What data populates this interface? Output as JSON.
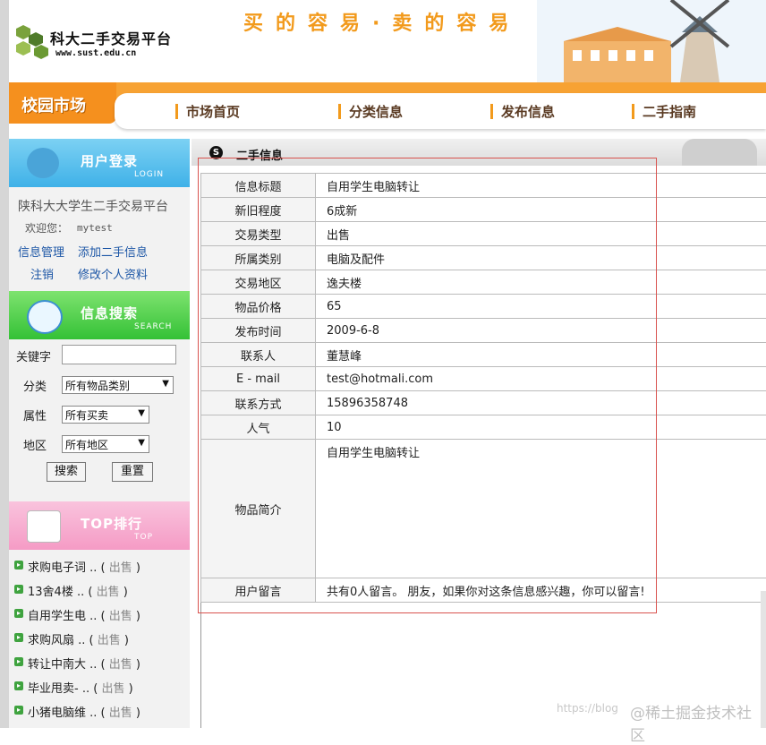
{
  "header": {
    "site_name": "科大二手交易平台",
    "site_url": "www.sust.edu.cn",
    "slogan": "买的容易·卖的容易"
  },
  "nav": {
    "market_label": "校园市场",
    "items": [
      "市场首页",
      "分类信息",
      "发布信息",
      "二手指南"
    ]
  },
  "sidebar": {
    "login": {
      "title": "用户登录",
      "subtitle": "LOGIN",
      "platform_text": "陕科大大学生二手交易平台",
      "welcome_text": "欢迎您：",
      "username": "mytest",
      "links": [
        "信息管理",
        "添加二手信息",
        "注销",
        "修改个人资料"
      ]
    },
    "search": {
      "title": "信息搜索",
      "subtitle": "SEARCH",
      "keyword_label": "关键字",
      "keyword_value": "",
      "category_label": "分类",
      "category_value": "所有物品类别",
      "attribute_label": "属性",
      "attribute_value": "所有买卖",
      "region_label": "地区",
      "region_value": "所有地区",
      "search_button": "搜索",
      "reset_button": "重置"
    },
    "top": {
      "title": "TOP排行",
      "subtitle": "TOP",
      "items": [
        {
          "name": "求购电子词 ..",
          "status": "出售"
        },
        {
          "name": "13舍4楼 ..",
          "status": "出售"
        },
        {
          "name": "自用学生电 ..",
          "status": "出售"
        },
        {
          "name": "求购风扇 ..",
          "status": "出售"
        },
        {
          "name": "转让中南大 ..",
          "status": "出售"
        },
        {
          "name": "毕业甩卖- ..",
          "status": "出售"
        },
        {
          "name": "小猪电脑维 ..",
          "status": "出售"
        }
      ]
    }
  },
  "main": {
    "section_title": "二手信息",
    "rows": [
      {
        "label": "信息标题",
        "value": "自用学生电脑转让"
      },
      {
        "label": "新旧程度",
        "value": "6成新"
      },
      {
        "label": "交易类型",
        "value": "出售"
      },
      {
        "label": "所属类别",
        "value": "电脑及配件"
      },
      {
        "label": "交易地区",
        "value": "逸夫楼"
      },
      {
        "label": "物品价格",
        "value": "65"
      },
      {
        "label": "发布时间",
        "value": "2009-6-8"
      },
      {
        "label": "联系人",
        "value": "董慧峰"
      },
      {
        "label": "E - mail",
        "value": "test@hotmali.com"
      },
      {
        "label": "联系方式",
        "value": "15896358748"
      },
      {
        "label": "人气",
        "value": "10"
      }
    ],
    "intro_label": "物品简介",
    "intro_value": "自用学生电脑转让",
    "comment_label": "用户留言",
    "comment_value": "共有0人留言。 朋友，如果你对这条信息感兴趣，你可以留言!"
  },
  "watermark": {
    "faint": "https://blog",
    "brand": "@稀土掘金技术社区"
  }
}
